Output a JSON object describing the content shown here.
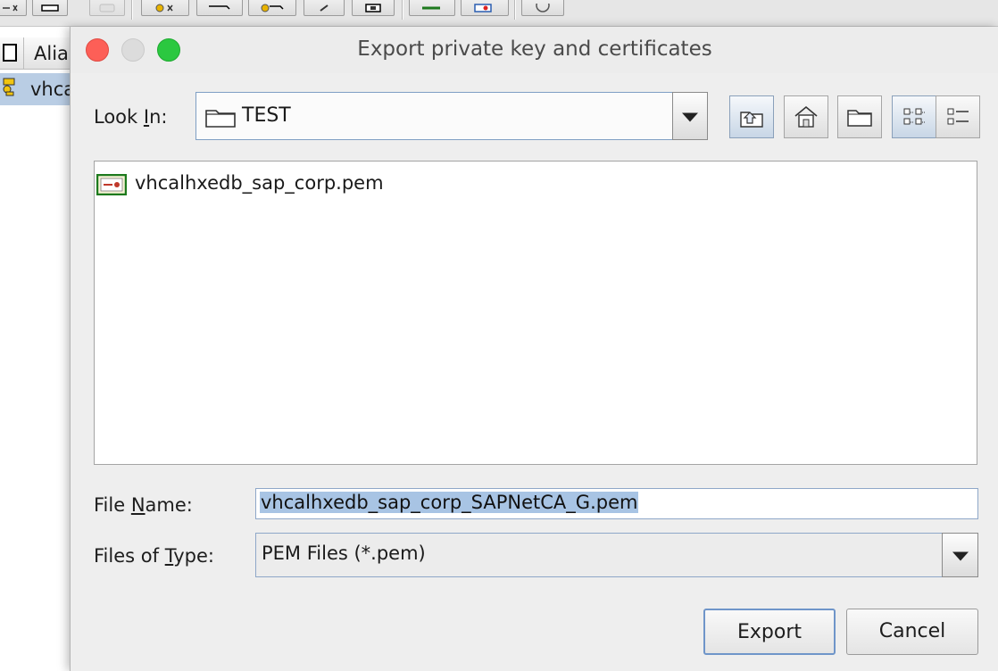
{
  "background_app": {
    "table": {
      "header_alias": "Alia",
      "row_alias": "vhca"
    }
  },
  "dialog": {
    "title": "Export private key and certificates",
    "look_in": {
      "label_pre": "Look ",
      "label_mnemonic": "I",
      "label_post": "n:",
      "value": "TEST"
    },
    "nav_buttons": [
      {
        "name": "up-one-level-icon"
      },
      {
        "name": "home-icon"
      },
      {
        "name": "new-folder-icon"
      },
      {
        "name": "list-view-icon"
      },
      {
        "name": "details-view-icon"
      }
    ],
    "files": [
      {
        "name": "vhcalhxedb_sap_corp.pem",
        "icon": "certificate-file-icon"
      }
    ],
    "file_name": {
      "label_pre": "File ",
      "label_mnemonic": "N",
      "label_post": "ame:",
      "value": "vhcalhxedb_sap_corp_SAPNetCA_G.pem"
    },
    "files_of_type": {
      "label_pre": "Files of ",
      "label_mnemonic": "T",
      "label_post": "ype:",
      "value": "PEM Files (*.pem)"
    },
    "buttons": {
      "export": "Export",
      "cancel": "Cancel"
    }
  },
  "colors": {
    "selection": "#a8c4e4",
    "focus_border": "#6f95c9",
    "close": "#fd5f57",
    "maximize": "#2bc840"
  }
}
